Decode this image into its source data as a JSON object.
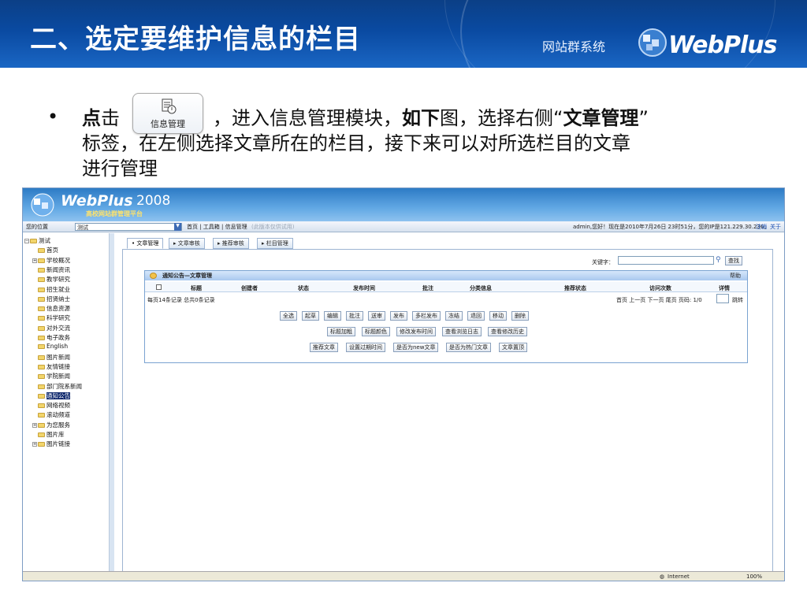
{
  "slide": {
    "title": "二、选定要维护信息的栏目",
    "system_name": "网站群系统",
    "brand": "WebPlus"
  },
  "instruction": {
    "bullet": "•",
    "part1_bold": "点",
    "part1": "击",
    "inline_button_label": "信息管理",
    "part2": "，进入信息管理模块，",
    "part3_bold": "如下",
    "part3": "图，选择右侧“",
    "part4_bold": "文章管理",
    "part4": "”",
    "line2": "标签，在左侧选择文章所在的栏目，接下来可以对所选栏目的文章",
    "line3": "进行管理"
  },
  "app": {
    "logo_text": "WebPlus",
    "logo_version": "2008",
    "logo_subtitle": "高校网站群管理平台",
    "nav": {
      "location_label": "您的位置",
      "location_value": "测试",
      "breadcrumb": "首页 | 工具箱 | 信息管理",
      "breadcrumb_note": "(此版本仅供试用)",
      "user_info": "admin,您好！现在是2010年7月26日 23时51分，您的IP是121.229.30.236，",
      "logout": "注销",
      "about": "关于"
    },
    "tree": [
      {
        "label": "测试",
        "level": 0,
        "toggle": "−"
      },
      {
        "label": "首页",
        "level": 1
      },
      {
        "label": "学校概况",
        "level": 1,
        "toggle": "+"
      },
      {
        "label": "新闻资讯",
        "level": 1
      },
      {
        "label": "教学研究",
        "level": 1
      },
      {
        "label": "招生就业",
        "level": 1
      },
      {
        "label": "招贤纳士",
        "level": 1
      },
      {
        "label": "信息资源",
        "level": 1
      },
      {
        "label": "科学研究",
        "level": 1
      },
      {
        "label": "对外交流",
        "level": 1
      },
      {
        "label": "电子政务",
        "level": 1
      },
      {
        "label": "English",
        "level": 1
      },
      {
        "label": "图片新闻",
        "level": 1
      },
      {
        "label": "友情链接",
        "level": 1
      },
      {
        "label": "学院新闻",
        "level": 1
      },
      {
        "label": "部门院系新闻",
        "level": 1
      },
      {
        "label": "通知公告",
        "level": 1,
        "selected": true
      },
      {
        "label": "网络视频",
        "level": 1
      },
      {
        "label": "滚动频道",
        "level": 1
      },
      {
        "label": "为您服务",
        "level": 1,
        "toggle": "+"
      },
      {
        "label": "图片库",
        "level": 1
      },
      {
        "label": "图片链接",
        "level": 1,
        "toggle": "+"
      }
    ],
    "tabs": [
      "文章管理",
      "文章审核",
      "推荐审核",
      "栏目管理"
    ],
    "search": {
      "label": "关键字：",
      "button": "查找"
    },
    "grid": {
      "title": "通知公告—文章管理",
      "help": "帮助",
      "columns": [
        "标题",
        "创建者",
        "状态",
        "发布时间",
        "批注",
        "分类信息",
        "推荐状态",
        "访问次数",
        "详情"
      ],
      "record_info": "每页14条记录  总共0条记录",
      "pager": "首页  上一页  下一页  尾页  页码: 1/0",
      "jump": "跳转"
    },
    "buttons_row1": [
      "全选",
      "起草",
      "编辑",
      "批注",
      "送审",
      "发布",
      "多栏发布",
      "冻结",
      "退回",
      "移动",
      "删除"
    ],
    "buttons_row2": [
      "标题加粗",
      "标题颜色",
      "修改发布时间",
      "查看浏览日志",
      "查看修改历史"
    ],
    "buttons_row3": [
      "推荐文章",
      "设置过期时间",
      "是否为new文章",
      "是否为热门文章",
      "文章置顶"
    ],
    "statusbar": {
      "zone": "Internet",
      "zoom": "100%"
    }
  },
  "colors": {
    "header_blue": "#0b3f86",
    "accent": "#1a66c4"
  }
}
